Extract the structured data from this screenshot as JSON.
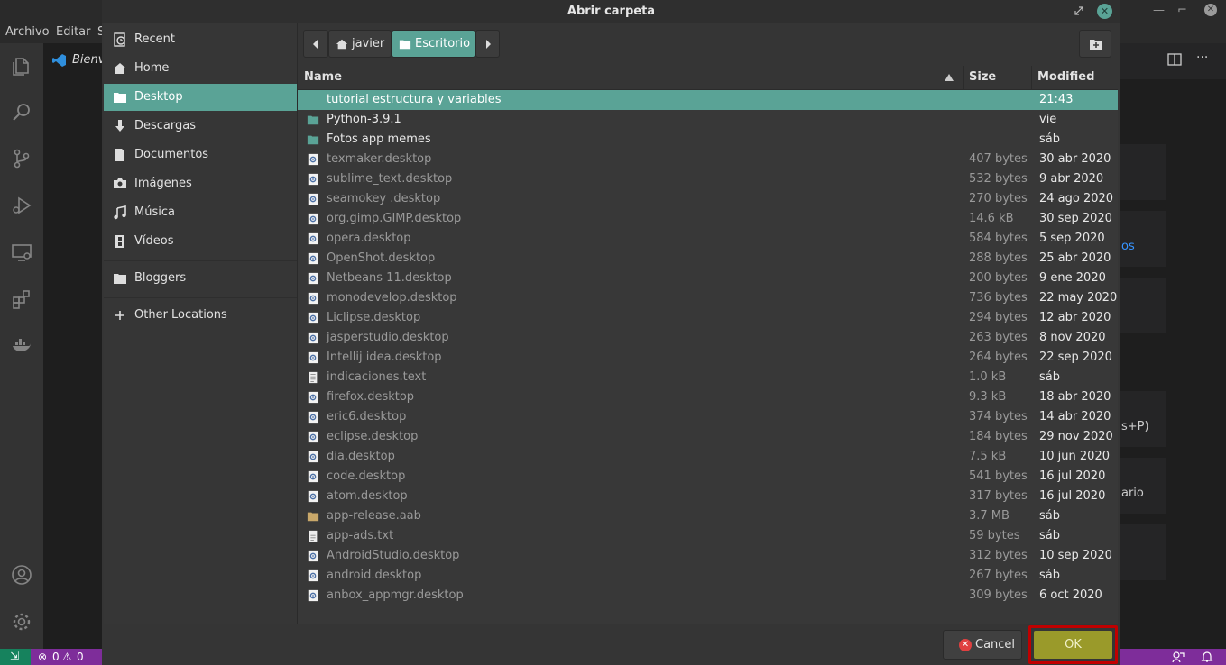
{
  "vscode": {
    "menu": [
      "Archivo",
      "Editar",
      "S"
    ],
    "tab_title": "Bienv",
    "right_fragments": [
      "os",
      "s+P)",
      "ario"
    ],
    "status": {
      "errors": "0",
      "warnings": "0"
    }
  },
  "dialog": {
    "title": "Abrir carpeta",
    "sidebar": [
      {
        "label": "Recent",
        "icon": "recent-icon"
      },
      {
        "label": "Home",
        "icon": "home-icon"
      },
      {
        "label": "Desktop",
        "icon": "desktop-folder-icon",
        "selected": true
      },
      {
        "label": "Descargas",
        "icon": "download-icon"
      },
      {
        "label": "Documentos",
        "icon": "document-icon"
      },
      {
        "label": "Imágenes",
        "icon": "camera-icon"
      },
      {
        "label": "Música",
        "icon": "music-icon"
      },
      {
        "label": "Vídeos",
        "icon": "film-icon"
      },
      {
        "label": "Bloggers",
        "icon": "folder-icon"
      },
      {
        "label": "Other Locations",
        "icon": "plus-icon"
      }
    ],
    "pathbar": [
      "javier",
      "Escritorio"
    ],
    "columns": {
      "name": "Name",
      "size": "Size",
      "modified": "Modified"
    },
    "files": [
      {
        "name": "tutorial estructura y variables",
        "size": "",
        "modified": "21:43",
        "icon": "folder",
        "selected": true
      },
      {
        "name": "Python-3.9.1",
        "size": "",
        "modified": "vie",
        "icon": "folder"
      },
      {
        "name": "Fotos app memes",
        "size": "",
        "modified": "sáb",
        "icon": "folder"
      },
      {
        "name": "texmaker.desktop",
        "size": "407 bytes",
        "modified": "30 abr 2020",
        "icon": "desktop"
      },
      {
        "name": "sublime_text.desktop",
        "size": "532 bytes",
        "modified": "9 abr 2020",
        "icon": "desktop"
      },
      {
        "name": "seamokey .desktop",
        "size": "270 bytes",
        "modified": "24 ago 2020",
        "icon": "desktop"
      },
      {
        "name": "org.gimp.GIMP.desktop",
        "size": "14.6 kB",
        "modified": "30 sep 2020",
        "icon": "desktop"
      },
      {
        "name": "opera.desktop",
        "size": "584 bytes",
        "modified": "5 sep 2020",
        "icon": "desktop"
      },
      {
        "name": "OpenShot.desktop",
        "size": "288 bytes",
        "modified": "25 abr 2020",
        "icon": "desktop"
      },
      {
        "name": "Netbeans 11.desktop",
        "size": "200 bytes",
        "modified": "9 ene 2020",
        "icon": "desktop"
      },
      {
        "name": "monodevelop.desktop",
        "size": "736 bytes",
        "modified": "22 may 2020",
        "icon": "desktop"
      },
      {
        "name": "Liclipse.desktop",
        "size": "294 bytes",
        "modified": "12 abr 2020",
        "icon": "desktop"
      },
      {
        "name": "jasperstudio.desktop",
        "size": "263 bytes",
        "modified": "8 nov 2020",
        "icon": "desktop"
      },
      {
        "name": "Intellij idea.desktop",
        "size": "264 bytes",
        "modified": "22 sep 2020",
        "icon": "desktop"
      },
      {
        "name": "indicaciones.text",
        "size": "1.0 kB",
        "modified": "sáb",
        "icon": "text"
      },
      {
        "name": "firefox.desktop",
        "size": "9.3 kB",
        "modified": "18 abr 2020",
        "icon": "desktop"
      },
      {
        "name": "eric6.desktop",
        "size": "374 bytes",
        "modified": "14 abr 2020",
        "icon": "desktop"
      },
      {
        "name": "eclipse.desktop",
        "size": "184 bytes",
        "modified": "29 nov 2020",
        "icon": "desktop"
      },
      {
        "name": "dia.desktop",
        "size": "7.5 kB",
        "modified": "10 jun 2020",
        "icon": "desktop"
      },
      {
        "name": "code.desktop",
        "size": "541 bytes",
        "modified": "16 jul 2020",
        "icon": "desktop"
      },
      {
        "name": "atom.desktop",
        "size": "317 bytes",
        "modified": "16 jul 2020",
        "icon": "desktop"
      },
      {
        "name": "app-release.aab",
        "size": "3.7 MB",
        "modified": "sáb",
        "icon": "archive"
      },
      {
        "name": "app-ads.txt",
        "size": "59 bytes",
        "modified": "sáb",
        "icon": "text"
      },
      {
        "name": "AndroidStudio.desktop",
        "size": "312 bytes",
        "modified": "10 sep 2020",
        "icon": "desktop"
      },
      {
        "name": "android.desktop",
        "size": "267 bytes",
        "modified": "sáb",
        "icon": "desktop"
      },
      {
        "name": "anbox_appmgr.desktop",
        "size": "309 bytes",
        "modified": "6 oct 2020",
        "icon": "desktop"
      }
    ],
    "buttons": {
      "cancel": "Cancel",
      "ok": "OK"
    }
  },
  "colors": {
    "accent": "#5aa396",
    "ok_button": "#9a9a2a",
    "highlight_outline": "#c00000"
  }
}
